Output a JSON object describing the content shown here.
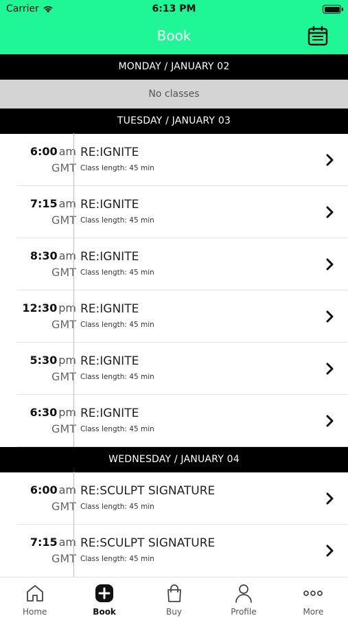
{
  "status_bar": {
    "carrier": "Carrier",
    "time": "6:13 PM"
  },
  "nav": {
    "title": "Book",
    "calendar_icon": "calendar-icon"
  },
  "day1": {
    "header": "MONDAY / JANUARY 02",
    "empty_text": "No classes"
  },
  "day2": {
    "header": "TUESDAY / JANUARY 03",
    "classes": [
      {
        "time": "6:00",
        "ampm": "am",
        "tz": "GMT",
        "name": "RE:IGNITE",
        "length": "Class length: 45 min"
      },
      {
        "time": "7:15",
        "ampm": "am",
        "tz": "GMT",
        "name": "RE:IGNITE",
        "length": "Class length: 45 min"
      },
      {
        "time": "8:30",
        "ampm": "am",
        "tz": "GMT",
        "name": "RE:IGNITE",
        "length": "Class length: 45 min"
      },
      {
        "time": "12:30",
        "ampm": "pm",
        "tz": "GMT",
        "name": "RE:IGNITE",
        "length": "Class length: 45 min"
      },
      {
        "time": "5:30",
        "ampm": "pm",
        "tz": "GMT",
        "name": "RE:IGNITE",
        "length": "Class length: 45 min"
      },
      {
        "time": "6:30",
        "ampm": "pm",
        "tz": "GMT",
        "name": "RE:IGNITE",
        "length": "Class length: 45 min"
      }
    ]
  },
  "day3": {
    "header": "WEDNESDAY / JANUARY 04",
    "classes": [
      {
        "time": "6:00",
        "ampm": "am",
        "tz": "GMT",
        "name": "RE:SCULPT SIGNATURE",
        "length": "Class length: 45 min"
      },
      {
        "time": "7:15",
        "ampm": "am",
        "tz": "GMT",
        "name": "RE:SCULPT SIGNATURE",
        "length": "Class length: 45 min"
      }
    ]
  },
  "tabs": [
    {
      "label": "Home",
      "icon": "home-icon"
    },
    {
      "label": "Book",
      "icon": "plus-square-icon",
      "active": true
    },
    {
      "label": "Buy",
      "icon": "shopping-bag-icon"
    },
    {
      "label": "Profile",
      "icon": "person-icon"
    },
    {
      "label": "More",
      "icon": "more-dots-icon"
    }
  ],
  "colors": {
    "header_bg": "#1ff796",
    "day_header_bg": "#000000",
    "no_classes_bg": "#d4d4d4"
  }
}
